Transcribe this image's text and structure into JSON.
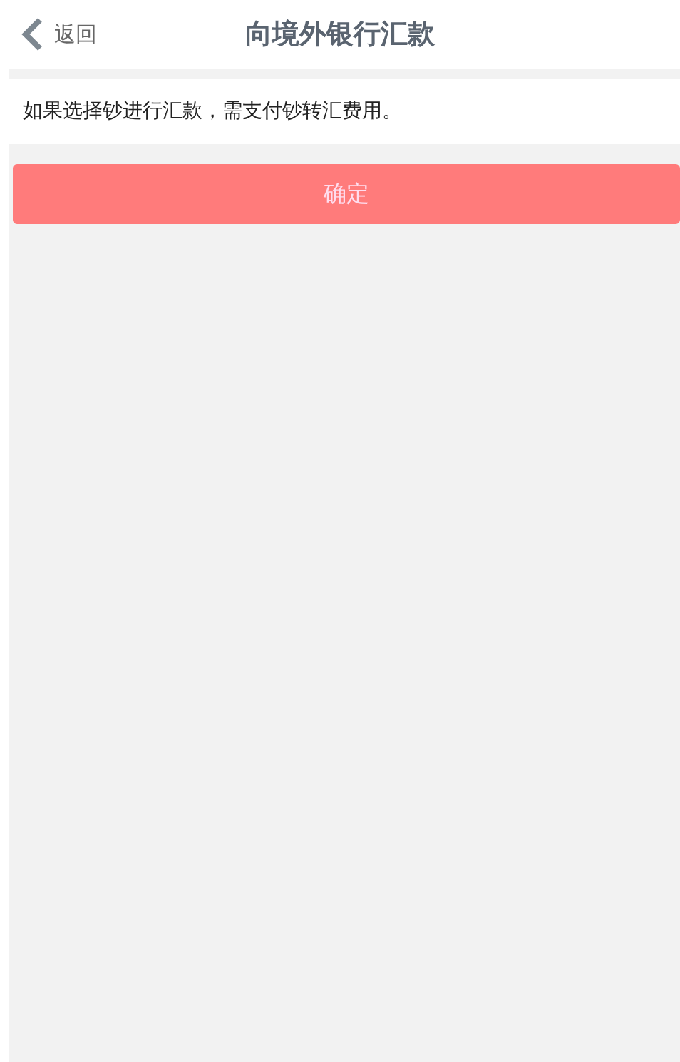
{
  "header": {
    "back": "返回",
    "title": "向境外银行汇款"
  },
  "notice": "如果选择钞进行汇款，需支付钞转汇费用。",
  "confirm_button": "确定"
}
